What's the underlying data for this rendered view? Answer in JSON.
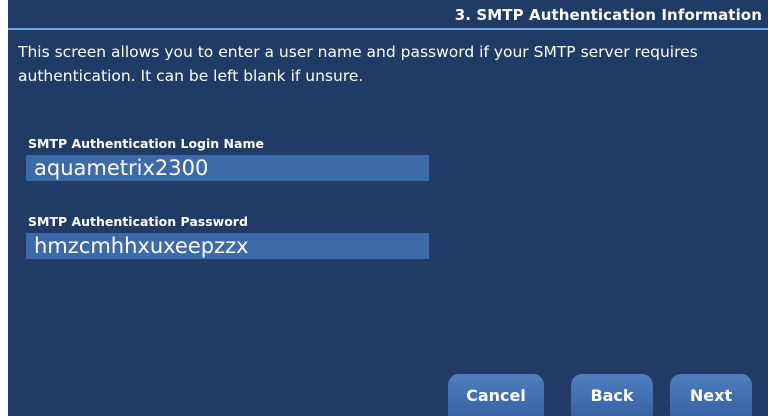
{
  "header": {
    "title": "3. SMTP Authentication Information"
  },
  "intro_text": "This screen allows you to enter a user name and password if your SMTP server requires authentication. It can be left blank if unsure.",
  "fields": {
    "login": {
      "label": "SMTP Authentication Login Name",
      "value": "aquametrix2300"
    },
    "password": {
      "label": "SMTP Authentication Password",
      "value": "hmzcmhhxuxeepzzx"
    }
  },
  "buttons": {
    "cancel": "Cancel",
    "back": "Back",
    "next": "Next"
  },
  "colors": {
    "background": "#1f3b66",
    "field": "#3d6aa8",
    "button": "#4a78b8",
    "rule": "#6fa6dc"
  }
}
